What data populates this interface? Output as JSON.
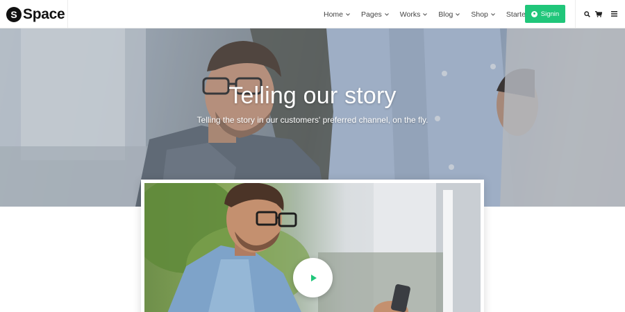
{
  "brand": {
    "mark": "S",
    "name": "Space"
  },
  "nav": {
    "items": [
      {
        "label": "Home",
        "has_dropdown": true
      },
      {
        "label": "Pages",
        "has_dropdown": true
      },
      {
        "label": "Works",
        "has_dropdown": true
      },
      {
        "label": "Blog",
        "has_dropdown": true
      },
      {
        "label": "Shop",
        "has_dropdown": true
      },
      {
        "label": "Starter",
        "has_dropdown": false
      }
    ],
    "signin_label": "Signin",
    "tools": [
      "search-icon",
      "cart-icon",
      "menu-icon"
    ]
  },
  "hero": {
    "title": "Telling our story",
    "subtitle": "Telling the story in our customers' preferred channel, on the fly."
  },
  "video": {
    "play_icon": "play-icon"
  },
  "colors": {
    "accent": "#20c67a",
    "text": "#444444",
    "brand_dark": "#111111"
  }
}
